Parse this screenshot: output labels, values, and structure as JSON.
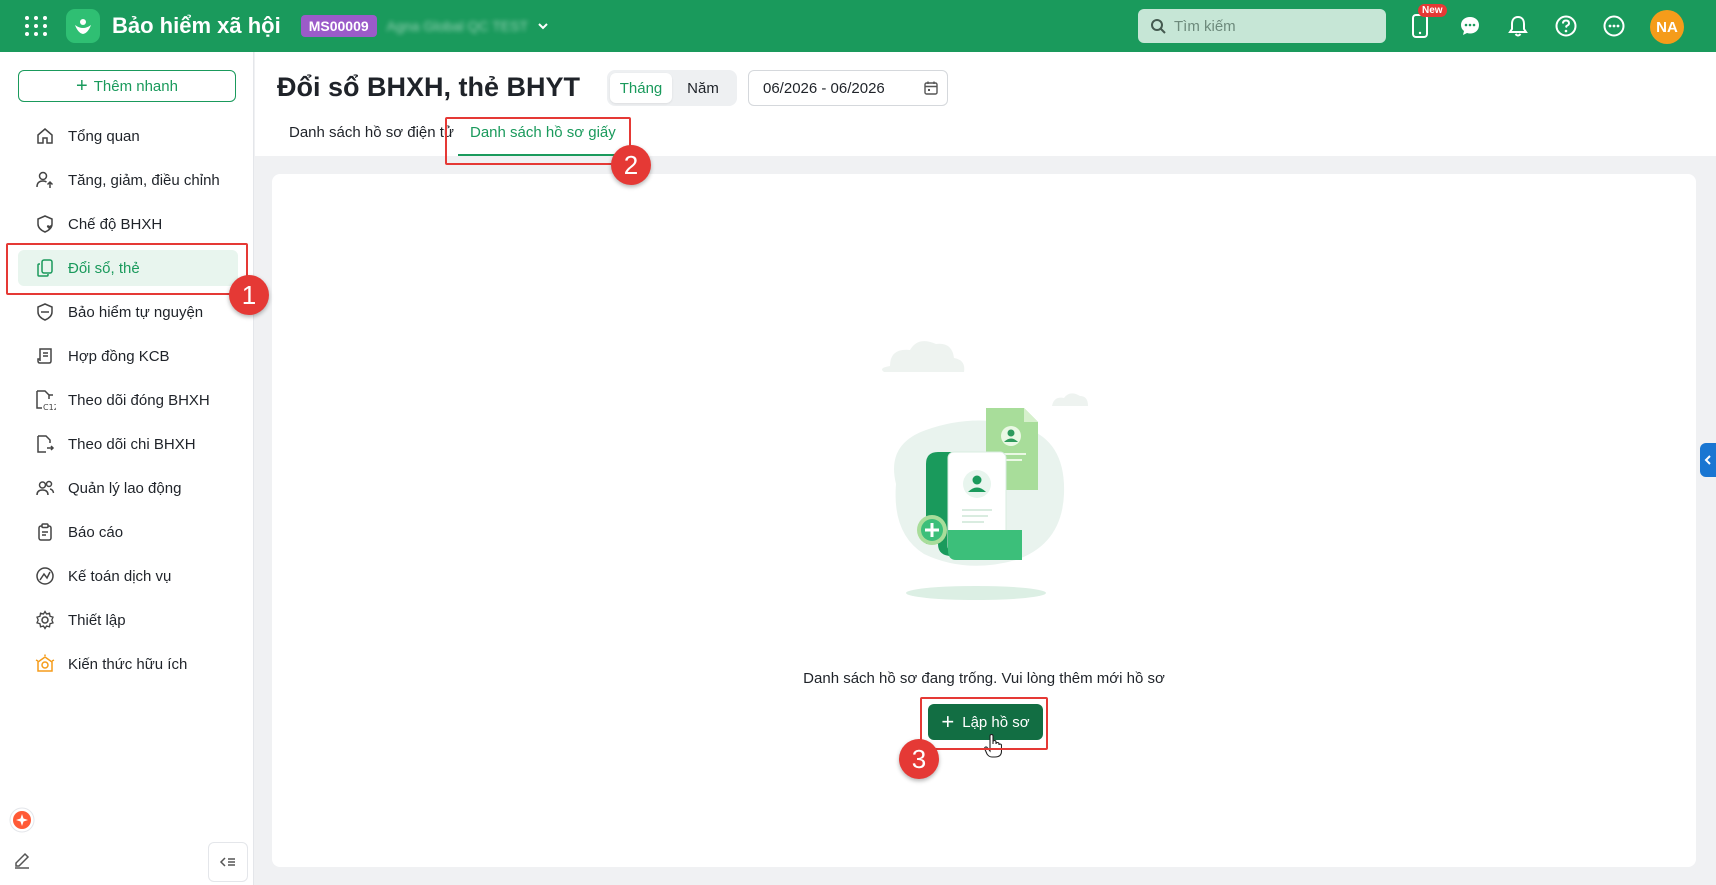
{
  "app": {
    "title": "Bảo hiểm xã hội",
    "badge": "MS00009",
    "company": "Agna Global QC TEST"
  },
  "search": {
    "placeholder": "Tìm kiếm"
  },
  "topbar": {
    "new_label": "New",
    "avatar_initials": "NA"
  },
  "sidebar": {
    "quick_add": "Thêm nhanh",
    "items": [
      {
        "label": "Tổng quan",
        "icon": "home-icon"
      },
      {
        "label": "Tăng, giảm, điều chỉnh",
        "icon": "user-up-icon"
      },
      {
        "label": "Chế độ BHXH",
        "icon": "shield-heart-icon"
      },
      {
        "label": "Đổi sổ, thẻ",
        "icon": "copy-icon",
        "active": true
      },
      {
        "label": "Bảo hiểm tự nguyện",
        "icon": "shield-icon"
      },
      {
        "label": "Hợp đồng KCB",
        "icon": "scroll-icon"
      },
      {
        "label": "Theo dõi đóng BHXH",
        "icon": "doc-c12-icon"
      },
      {
        "label": "Theo dõi chi BHXH",
        "icon": "doc-out-icon"
      },
      {
        "label": "Quản lý lao động",
        "icon": "users-icon"
      },
      {
        "label": "Báo cáo",
        "icon": "clipboard-icon"
      },
      {
        "label": "Kế toán dịch vụ",
        "icon": "chart-circle-icon"
      },
      {
        "label": "Thiết lập",
        "icon": "gear-icon"
      },
      {
        "label": "Kiến thức hữu ích",
        "icon": "lightbulb-icon"
      }
    ]
  },
  "header": {
    "title": "Đổi sổ BHXH, thẻ BHYT",
    "period_options": [
      "Tháng",
      "Năm"
    ],
    "period_selected": "Tháng",
    "date_range": "06/2026 - 06/2026",
    "tabs": [
      "Danh sách hồ sơ điện tử",
      "Danh sách hồ sơ giấy"
    ],
    "active_tab": "Danh sách hồ sơ giấy"
  },
  "content": {
    "empty_message": "Danh sách hồ sơ đang trống. Vui lòng thêm mới hồ sơ",
    "create_button": "Lập hồ sơ"
  },
  "annotations": [
    "1",
    "2",
    "3"
  ],
  "colors": {
    "brand": "#1a9a5c",
    "button": "#126e43",
    "highlight": "#e53935",
    "badge": "#9b5bc9",
    "avatar": "#f59c1a"
  }
}
